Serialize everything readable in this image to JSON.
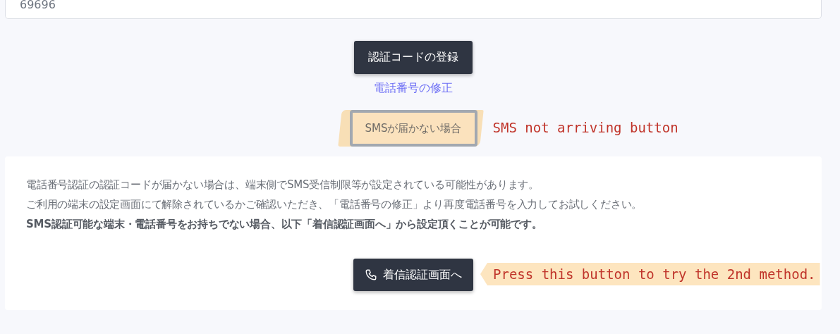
{
  "code_field": {
    "value": "69696"
  },
  "register_button": {
    "label": "認証コードの登録"
  },
  "edit_phone_link": {
    "label": "電話番号の修正"
  },
  "sms_button": {
    "label": "SMSが届かない場合",
    "highlighted": true
  },
  "sms_annotation": {
    "text": "SMS not arriving button"
  },
  "notice": {
    "lines": [
      {
        "kind": "plain",
        "text": "電話番号認証の認証コードが届かない場合は、端末側でSMS受信制限等が設定されている可能性があります。"
      },
      {
        "kind": "plain",
        "text": "ご利用の端末の設定画面にて解除されているかご確認いただき、「電話番号の修正」より再度電話番号を入力してお試しください。"
      },
      {
        "kind": "bold",
        "text": "SMS認証可能な端末・電話番号をお持ちでない場合、以下「着信認証画面へ」から設定頂くことが可能です。"
      }
    ]
  },
  "call_button": {
    "label": "着信認証画面へ"
  },
  "call_annotation": {
    "text": "Press this button to try the 2nd method."
  }
}
